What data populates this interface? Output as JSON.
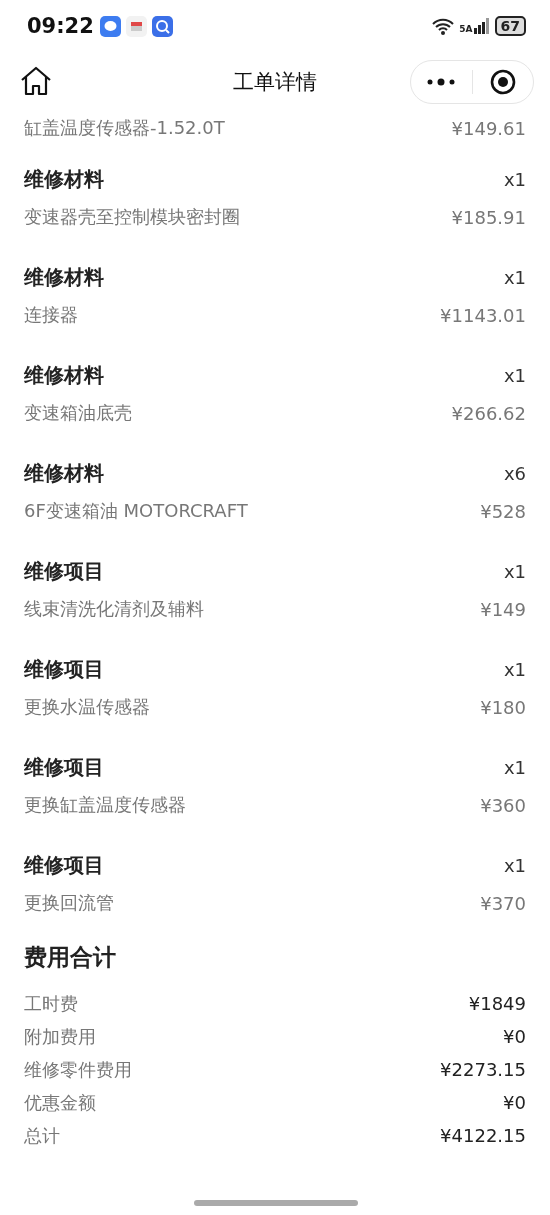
{
  "status_bar": {
    "time": "09:22",
    "network": "5A",
    "battery": "67"
  },
  "header": {
    "title": "工单详情"
  },
  "partial_item": {
    "name": "缸盖温度传感器-1.52.0T",
    "price": "¥149.61"
  },
  "items": [
    {
      "category": "维修材料",
      "qty": "x1",
      "name": "变速器壳至控制模块密封圈",
      "price": "¥185.91"
    },
    {
      "category": "维修材料",
      "qty": "x1",
      "name": "连接器",
      "price": "¥1143.01"
    },
    {
      "category": "维修材料",
      "qty": "x1",
      "name": "变速箱油底壳",
      "price": "¥266.62"
    },
    {
      "category": "维修材料",
      "qty": "x6",
      "name": "6F变速箱油 MOTORCRAFT",
      "price": "¥528"
    },
    {
      "category": "维修项目",
      "qty": "x1",
      "name": "线束清洗化清剂及辅料",
      "price": "¥149"
    },
    {
      "category": "维修项目",
      "qty": "x1",
      "name": "更换水温传感器",
      "price": "¥180"
    },
    {
      "category": "维修项目",
      "qty": "x1",
      "name": "更换缸盖温度传感器",
      "price": "¥360"
    },
    {
      "category": "维修项目",
      "qty": "x1",
      "name": "更换回流管",
      "price": "¥370"
    }
  ],
  "summary": {
    "title": "费用合计",
    "rows": [
      {
        "label": "工时费",
        "value": "¥1849"
      },
      {
        "label": "附加费用",
        "value": "¥0"
      },
      {
        "label": "维修零件费用",
        "value": "¥2273.15"
      },
      {
        "label": "优惠金额",
        "value": "¥0"
      },
      {
        "label": "总计",
        "value": "¥4122.15"
      }
    ]
  }
}
